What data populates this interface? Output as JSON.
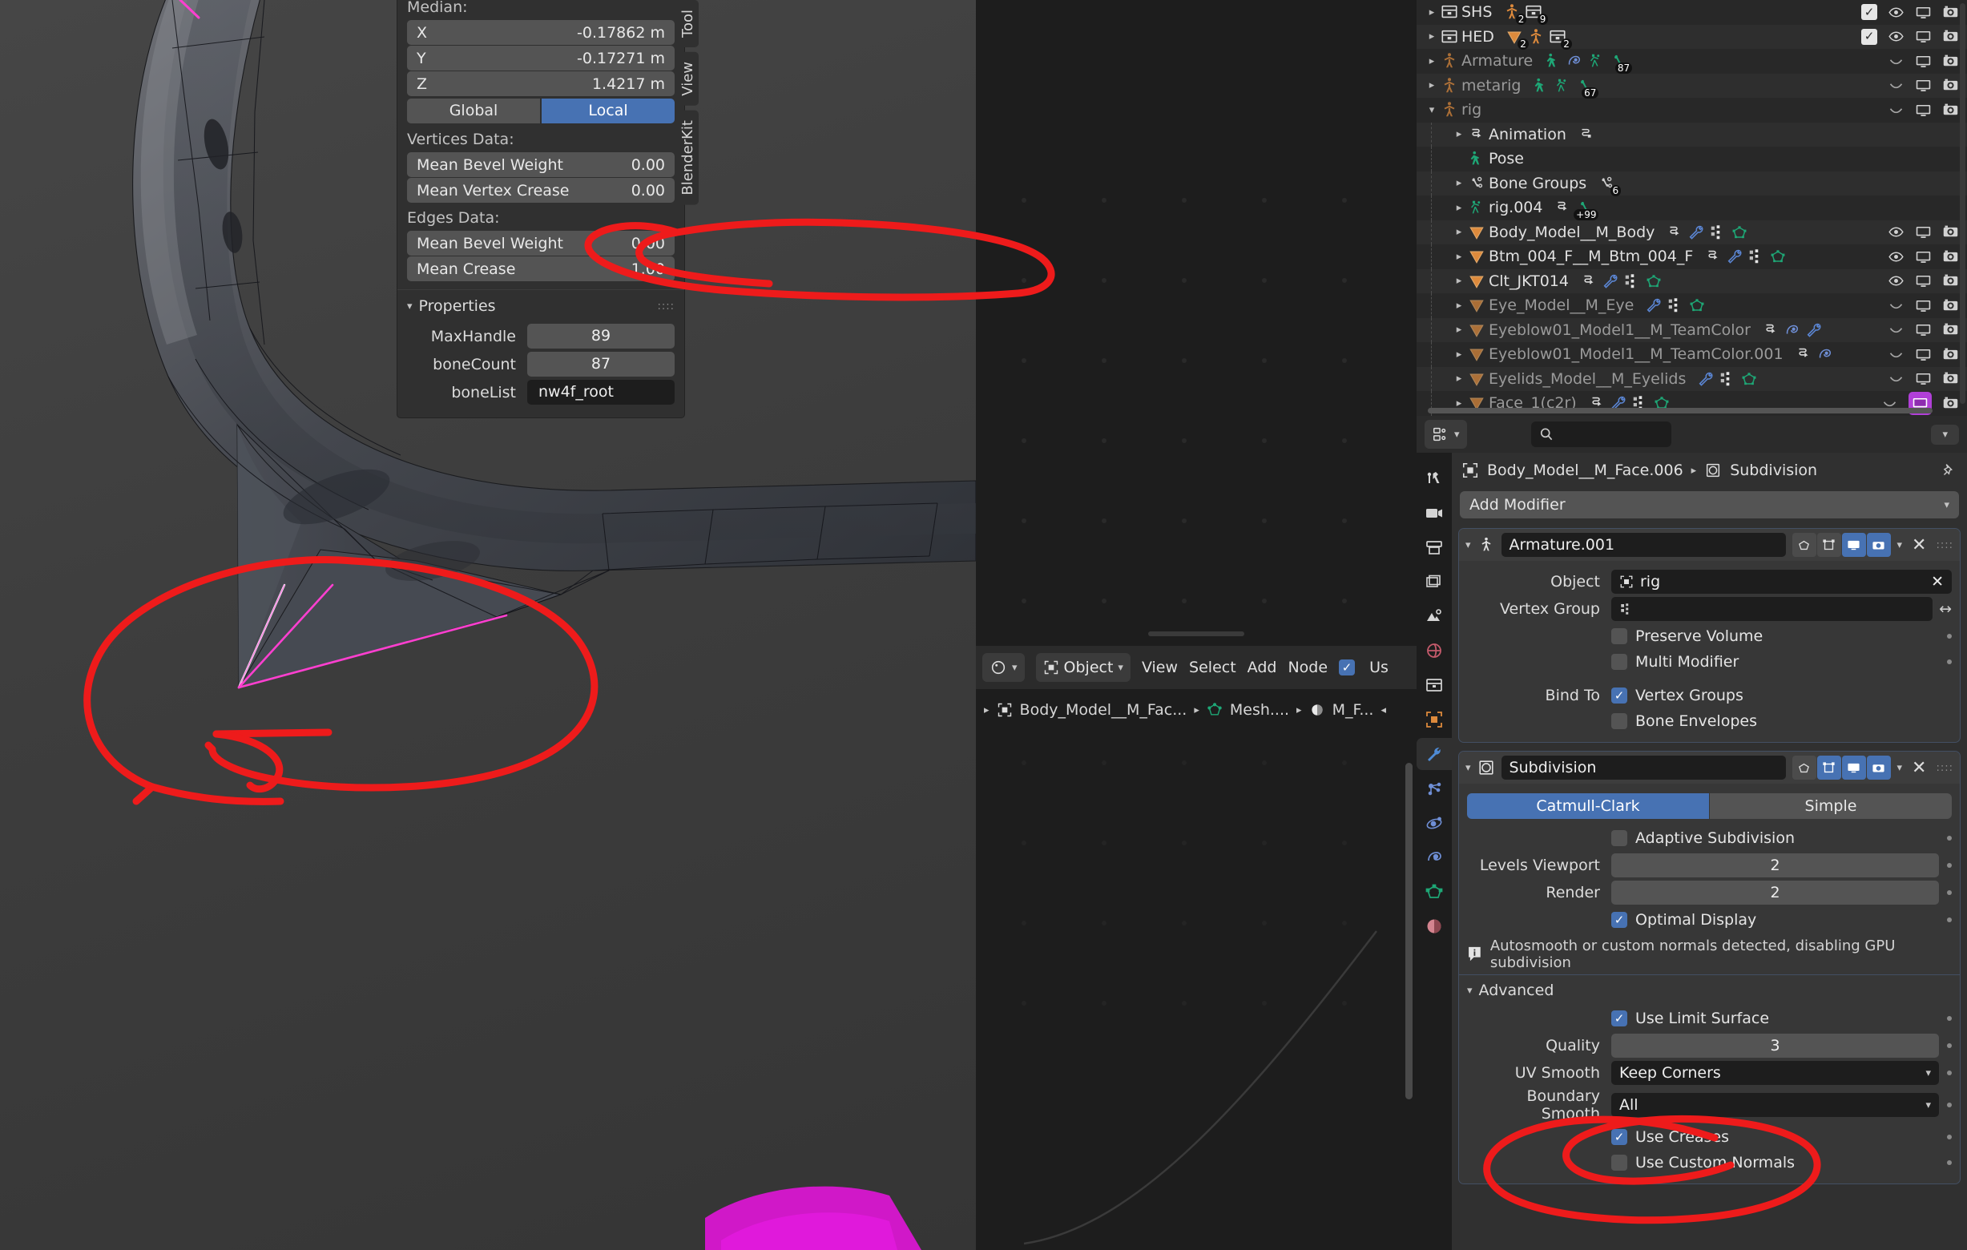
{
  "viewport": {
    "sidebar": {
      "tabs": [
        "Tool",
        "View",
        "BlenderKit"
      ],
      "active_tab": "Tool",
      "transform": {
        "median_label": "Median:",
        "rows": [
          {
            "axis": "X",
            "value": "-0.17862 m"
          },
          {
            "axis": "Y",
            "value": "-0.17271 m"
          },
          {
            "axis": "Z",
            "value": "1.4217 m"
          }
        ],
        "space_global": "Global",
        "space_local": "Local",
        "space_active": "Local"
      },
      "vertices_data": {
        "label": "Vertices Data:",
        "rows": [
          {
            "label": "Mean Bevel Weight",
            "value": "0.00"
          },
          {
            "label": "Mean Vertex Crease",
            "value": "0.00"
          }
        ]
      },
      "edges_data": {
        "label": "Edges Data:",
        "rows": [
          {
            "label": "Mean Bevel Weight",
            "value": "0.00"
          },
          {
            "label": "Mean Crease",
            "value": "1.00"
          }
        ]
      },
      "properties_panel": {
        "title": "Properties",
        "rows": [
          {
            "label": "MaxHandle",
            "value": "89",
            "dark": false
          },
          {
            "label": "boneCount",
            "value": "87",
            "dark": false
          },
          {
            "label": "boneList",
            "value": "nw4f_root",
            "dark": true
          }
        ]
      }
    },
    "gizmo": {
      "nav_buttons": [
        "zoom-icon",
        "pan-hand-icon",
        "camera-icon",
        "perspective-grid-icon"
      ],
      "axis_colors": {
        "x": "#cc4b5e",
        "y": "#8bc24a",
        "z": "#3e7bb5"
      }
    }
  },
  "node_editor": {
    "header": {
      "editor_type": "shader-editor-icon",
      "shader_type": "Object",
      "menus": [
        "View",
        "Select",
        "Add",
        "Node"
      ],
      "use_nodes_label": "Us",
      "use_nodes_checked": true
    },
    "breadcrumb": [
      "Body_Model__M_Fac...",
      "Mesh....",
      "M_F..."
    ]
  },
  "outliner": {
    "rows": [
      {
        "name": "SHS",
        "indent": 0,
        "icon": "collection-icon",
        "dim": false,
        "expanded": false,
        "badges": [
          {
            "icon": "armature-icon",
            "count": "2"
          },
          {
            "icon": "collection-icon",
            "count": "9"
          }
        ],
        "right": [
          "checkbox-checked",
          "eye-icon",
          "monitor-icon",
          "camera-icon"
        ]
      },
      {
        "name": "HED",
        "indent": 0,
        "icon": "collection-icon",
        "dim": false,
        "expanded": false,
        "badges": [
          {
            "icon": "mesh-tri-icon",
            "count": "2"
          },
          {
            "icon": "armature-icon",
            "count": ""
          },
          {
            "icon": "collection-icon",
            "count": "2"
          }
        ],
        "right": [
          "checkbox-checked",
          "eye-icon",
          "monitor-icon",
          "camera-icon"
        ]
      },
      {
        "name": "Armature",
        "indent": 0,
        "icon": "armature-icon",
        "dim": true,
        "expanded": false,
        "badges": [
          {
            "icon": "pose-icon",
            "count": ""
          },
          {
            "icon": "constraint-icon",
            "count": ""
          },
          {
            "icon": "armature-data-icon",
            "count": ""
          },
          {
            "icon": "bone-icon",
            "count": "87"
          }
        ],
        "right": [
          "eye-closed-icon",
          "monitor-icon",
          "camera-icon"
        ]
      },
      {
        "name": "metarig",
        "indent": 0,
        "icon": "armature-icon",
        "dim": true,
        "expanded": false,
        "badges": [
          {
            "icon": "pose-icon",
            "count": ""
          },
          {
            "icon": "armature-data-icon",
            "count": ""
          },
          {
            "icon": "bone-icon",
            "count": "67"
          }
        ],
        "right": [
          "eye-closed-icon",
          "monitor-icon",
          "camera-icon"
        ]
      },
      {
        "name": "rig",
        "indent": 0,
        "icon": "armature-icon",
        "dim": true,
        "expanded": true,
        "badges": [],
        "right": [
          "eye-closed-icon",
          "monitor-icon",
          "camera-icon"
        ]
      },
      {
        "name": "Animation",
        "indent": 1,
        "icon": "animation-icon",
        "dim": false,
        "expanded": false,
        "badges": [
          {
            "icon": "action-icon",
            "count": ""
          }
        ],
        "right": []
      },
      {
        "name": "Pose",
        "indent": 1,
        "icon": "pose-icon",
        "dim": false,
        "expanded": null,
        "badges": [],
        "right": []
      },
      {
        "name": "Bone Groups",
        "indent": 1,
        "icon": "bone-group-icon",
        "dim": false,
        "expanded": false,
        "badges": [
          {
            "icon": "bone-group-icon",
            "count": "6"
          }
        ],
        "right": []
      },
      {
        "name": "rig.004",
        "indent": 1,
        "icon": "armature-data-icon",
        "dim": false,
        "expanded": false,
        "badges": [
          {
            "icon": "animation-icon",
            "count": ""
          },
          {
            "icon": "bone-icon",
            "count": "+99"
          }
        ],
        "right": []
      },
      {
        "name": "Body_Model__M_Body",
        "indent": 1,
        "icon": "mesh-tri-icon",
        "dim": false,
        "expanded": false,
        "badges": [
          {
            "icon": "animation-icon",
            "count": ""
          },
          {
            "icon": "wrench-icon",
            "count": ""
          },
          {
            "icon": "vertex-group-icon",
            "count": ""
          },
          {
            "icon": "mesh-data-icon",
            "count": ""
          }
        ],
        "right": [
          "eye-icon",
          "monitor-icon",
          "camera-icon"
        ]
      },
      {
        "name": "Btm_004_F__M_Btm_004_F",
        "indent": 1,
        "icon": "mesh-tri-icon",
        "dim": false,
        "expanded": false,
        "badges": [
          {
            "icon": "animation-icon",
            "count": ""
          },
          {
            "icon": "wrench-icon",
            "count": ""
          },
          {
            "icon": "vertex-group-icon",
            "count": ""
          },
          {
            "icon": "mesh-data-icon",
            "count": ""
          }
        ],
        "right": [
          "eye-icon",
          "monitor-icon",
          "camera-icon"
        ]
      },
      {
        "name": "Clt_JKT014",
        "indent": 1,
        "icon": "mesh-tri-icon",
        "dim": false,
        "expanded": false,
        "badges": [
          {
            "icon": "animation-icon",
            "count": ""
          },
          {
            "icon": "wrench-icon",
            "count": ""
          },
          {
            "icon": "vertex-group-icon",
            "count": ""
          },
          {
            "icon": "mesh-data-icon",
            "count": ""
          }
        ],
        "right": [
          "eye-icon",
          "monitor-icon",
          "camera-icon"
        ]
      },
      {
        "name": "Eye_Model__M_Eye",
        "indent": 1,
        "icon": "mesh-tri-icon",
        "dim": true,
        "expanded": false,
        "badges": [
          {
            "icon": "wrench-icon",
            "count": ""
          },
          {
            "icon": "vertex-group-icon",
            "count": ""
          },
          {
            "icon": "mesh-data-icon",
            "count": ""
          }
        ],
        "right": [
          "eye-closed-icon",
          "monitor-icon",
          "camera-icon"
        ]
      },
      {
        "name": "Eyeblow01_Model1__M_TeamColor",
        "indent": 1,
        "icon": "mesh-tri-icon",
        "dim": true,
        "expanded": false,
        "badges": [
          {
            "icon": "animation-icon",
            "count": ""
          },
          {
            "icon": "constraint-icon",
            "count": ""
          },
          {
            "icon": "wrench-icon",
            "count": ""
          }
        ],
        "right": [
          "eye-closed-icon",
          "monitor-icon",
          "camera-icon"
        ]
      },
      {
        "name": "Eyeblow01_Model1__M_TeamColor.001",
        "indent": 1,
        "icon": "mesh-tri-icon",
        "dim": true,
        "expanded": false,
        "badges": [
          {
            "icon": "animation-icon",
            "count": ""
          },
          {
            "icon": "constraint-icon",
            "count": ""
          }
        ],
        "right": [
          "eye-closed-icon",
          "monitor-icon",
          "camera-icon"
        ]
      },
      {
        "name": "Eyelids_Model__M_Eyelids",
        "indent": 1,
        "icon": "mesh-tri-icon",
        "dim": true,
        "expanded": false,
        "badges": [
          {
            "icon": "wrench-icon",
            "count": ""
          },
          {
            "icon": "vertex-group-icon",
            "count": ""
          },
          {
            "icon": "mesh-data-icon",
            "count": ""
          }
        ],
        "right": [
          "eye-closed-icon",
          "monitor-icon",
          "camera-icon"
        ]
      },
      {
        "name": "Face_1(c2r)",
        "indent": 1,
        "icon": "mesh-tri-icon",
        "dim": true,
        "expanded": false,
        "badges": [
          {
            "icon": "animation-icon",
            "count": ""
          },
          {
            "icon": "wrench-icon",
            "count": ""
          },
          {
            "icon": "vertex-group-icon",
            "count": ""
          },
          {
            "icon": "mesh-data-icon",
            "count": ""
          }
        ],
        "right": [
          "eye-closed-icon",
          "monitor-icon-highlight",
          "camera-icon"
        ]
      }
    ]
  },
  "properties": {
    "header": {
      "editor_icon": "properties-editor-icon",
      "search_placeholder": ""
    },
    "tabs": [
      "tool-icon",
      "render-icon",
      "output-icon",
      "view-layer-icon",
      "scene-icon",
      "world-icon",
      "collection-icon",
      "object-icon",
      "modifier-icon",
      "particles-icon",
      "physics-icon",
      "constraint-icon",
      "data-icon",
      "material-icon"
    ],
    "active_tab": "modifier-icon",
    "breadcrumb": {
      "object": "Body_Model__M_Face.006",
      "modifier": "Subdivision"
    },
    "add_modifier": "Add Modifier",
    "modifiers": [
      {
        "name": "Armature.001",
        "icon": "armature-icon",
        "toggles": [
          {
            "icon": "edit-mode-icon",
            "on": false
          },
          {
            "icon": "cage-icon",
            "on": false
          },
          {
            "icon": "realtime-icon",
            "on": true
          },
          {
            "icon": "render-icon",
            "on": true
          }
        ],
        "fields": [
          {
            "type": "object",
            "label": "Object",
            "value": "rig",
            "icon": "object-icon"
          },
          {
            "type": "vgroup",
            "label": "Vertex Group",
            "value": "",
            "icon": "vertex-group-icon"
          },
          {
            "type": "checkbox",
            "label": "",
            "text": "Preserve Volume",
            "checked": false
          },
          {
            "type": "checkbox",
            "label": "",
            "text": "Multi Modifier",
            "checked": false
          },
          {
            "type": "checkbox",
            "label": "Bind To",
            "text": "Vertex Groups",
            "checked": true
          },
          {
            "type": "checkbox",
            "label": "",
            "text": "Bone Envelopes",
            "checked": false
          }
        ]
      },
      {
        "name": "Subdivision",
        "icon": "subdivision-icon",
        "toggles": [
          {
            "icon": "edit-mode-icon",
            "on": false
          },
          {
            "icon": "cage-icon",
            "on": true
          },
          {
            "icon": "realtime-icon",
            "on": true
          },
          {
            "icon": "render-icon",
            "on": true
          }
        ],
        "segments": {
          "options": [
            "Catmull-Clark",
            "Simple"
          ],
          "active": "Catmull-Clark"
        },
        "fields": [
          {
            "type": "checkbox",
            "label": "",
            "text": "Adaptive Subdivision",
            "checked": false
          },
          {
            "type": "number",
            "label": "Levels Viewport",
            "value": "2"
          },
          {
            "type": "number",
            "label": "Render",
            "value": "2"
          },
          {
            "type": "checkbox",
            "label": "",
            "text": "Optimal Display",
            "checked": true
          }
        ],
        "info": "Autosmooth or custom normals detected, disabling GPU subdivision",
        "advanced": {
          "title": "Advanced",
          "fields": [
            {
              "type": "checkbox",
              "label": "",
              "text": "Use Limit Surface",
              "checked": true
            },
            {
              "type": "number",
              "label": "Quality",
              "value": "3"
            },
            {
              "type": "dropdown",
              "label": "UV Smooth",
              "value": "Keep Corners"
            },
            {
              "type": "dropdown",
              "label": "Boundary Smooth",
              "value": "All"
            },
            {
              "type": "checkbox",
              "label": "",
              "text": "Use Creases",
              "checked": true
            },
            {
              "type": "checkbox",
              "label": "",
              "text": "Use Custom Normals",
              "checked": false
            }
          ]
        }
      }
    ]
  },
  "colors": {
    "accent_blue": "#4772b3",
    "annotation_red": "#ee1b1b",
    "selected_edge": "#ff3fd0",
    "highlight_purple": "#b13fd8",
    "mesh_orange": "#dd8a3c",
    "green_icon": "#1ea776"
  }
}
